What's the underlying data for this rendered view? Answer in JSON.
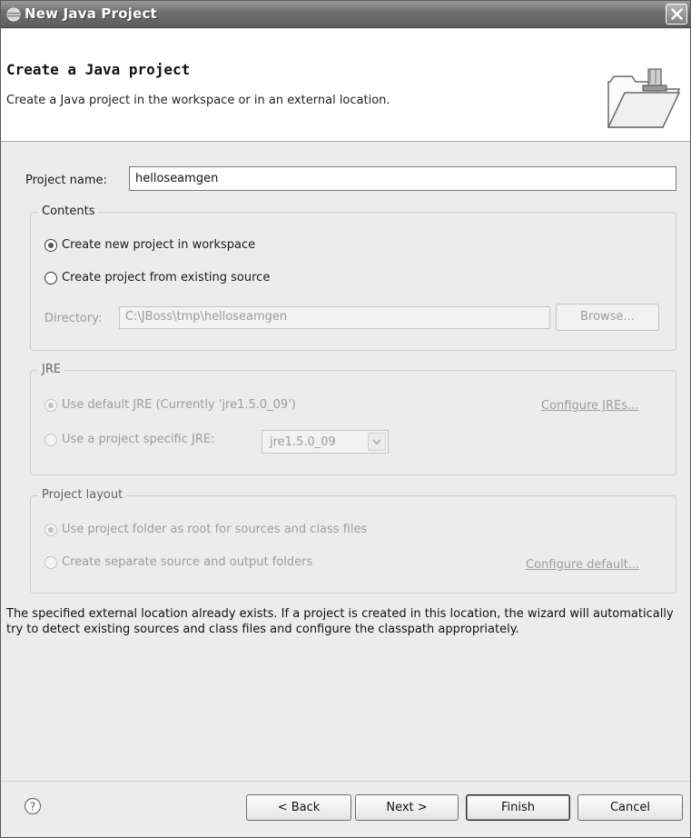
{
  "window": {
    "title": "New Java Project"
  },
  "header": {
    "title": "Create a Java project",
    "subtitle": "Create a Java project in the workspace or in an external location."
  },
  "project_name": {
    "label": "Project name:",
    "value": "helloseamgen"
  },
  "contents": {
    "legend": "Contents",
    "option_new": "Create new project in workspace",
    "option_existing": "Create project from existing source",
    "selected": "option_new",
    "directory_label": "Directory:",
    "directory_value": "C:\\JBoss\\tmp\\helloseamgen",
    "browse_label": "Browse..."
  },
  "jre": {
    "legend": "JRE",
    "option_default": "Use default JRE (Currently 'jre1.5.0_09')",
    "option_specific": "Use a project specific JRE:",
    "configure_link": "Configure JREs...",
    "selected_jre": "jre1.5.0_09"
  },
  "project_layout": {
    "legend": "Project layout",
    "option_root": "Use project folder as root for sources and class files",
    "option_separate": "Create separate source and output folders",
    "configure_link": "Configure default..."
  },
  "message": "The specified external location already exists. If a project is created in this location, the wizard will automatically try to detect existing sources and class files and configure the classpath appropriately.",
  "footer": {
    "back_label": "< Back",
    "next_label": "Next >",
    "finish_label": "Finish",
    "cancel_label": "Cancel"
  },
  "colors": {
    "titlebar": "#6d6d6d",
    "dialog_bg": "#ececec",
    "disabled_text": "#9d9d9d"
  }
}
